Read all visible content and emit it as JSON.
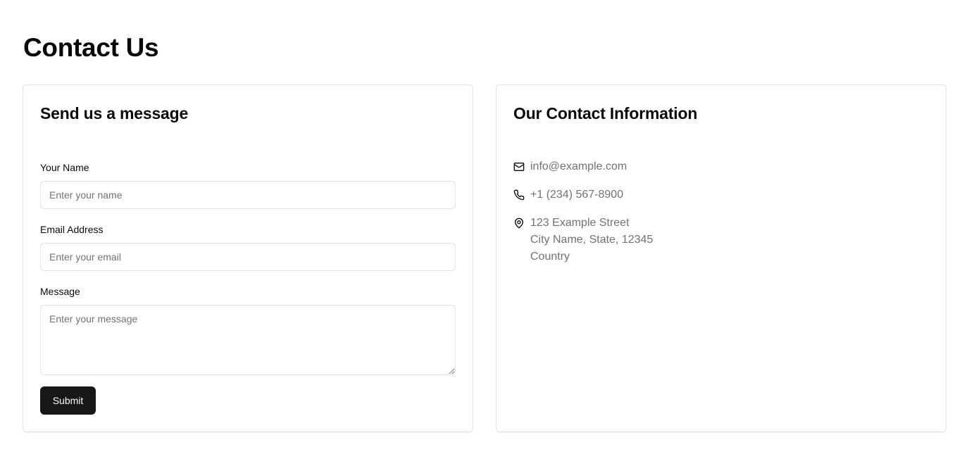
{
  "page": {
    "title": "Contact Us"
  },
  "form": {
    "title": "Send us a message",
    "name_label": "Your Name",
    "name_placeholder": "Enter your name",
    "email_label": "Email Address",
    "email_placeholder": "Enter your email",
    "message_label": "Message",
    "message_placeholder": "Enter your message",
    "submit_label": "Submit"
  },
  "contact": {
    "title": "Our Contact Information",
    "email": "info@example.com",
    "email_icon": "mail-icon",
    "phone": "+1 (234) 567-8900",
    "phone_icon": "phone-icon",
    "address_icon": "map-pin-icon",
    "address": {
      "line1": "123 Example Street",
      "line2": "City Name, State, 12345",
      "line3": "Country"
    }
  },
  "colors": {
    "primary_button": "#18181b",
    "muted_text": "#71717a",
    "border": "#e4e4e7"
  }
}
